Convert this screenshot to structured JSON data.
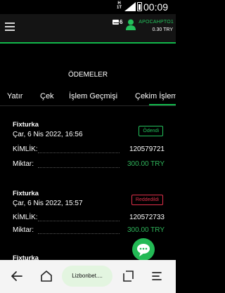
{
  "status_bar": {
    "network": "H",
    "network_sub": "1T",
    "time": "00:09"
  },
  "header": {
    "menu_icon": "hamburger-menu-icon",
    "mail_icon": "envelope-icon",
    "mail_count": "6",
    "avatar_icon": "user-avatar-icon",
    "username": "APOCAHPTO1",
    "balance": "0.30 TRY",
    "accent_color": "#11b84b"
  },
  "page_title": "ÖDEMELER",
  "tabs": [
    {
      "label": "Yatır"
    },
    {
      "label": "Çek"
    },
    {
      "label": "İşlem Geçmişi"
    },
    {
      "label": "Çekim İşlem",
      "active": true
    }
  ],
  "transactions": [
    {
      "title": "Fixturka",
      "date": "Çar, 6 Nis 2022, 16:56",
      "status": "Ödendi",
      "status_color": "#23c15b",
      "id_label": "KİMLİK:",
      "id_value": "120579721",
      "amount_label": "Miktar:",
      "amount_value": "300.00 TRY"
    },
    {
      "title": "Fixturka",
      "date": "Çar, 6 Nis 2022, 15:57",
      "status": "Reddedildi",
      "status_color": "#e0304a",
      "id_label": "KİMLİK:",
      "id_value": "120572733",
      "amount_label": "Miktar:",
      "amount_value": "300.00 TRY"
    },
    {
      "title": "Fixturka"
    }
  ],
  "chat_button_icon": "chat-bubble-icon",
  "browser_nav": {
    "back_icon": "back-arrow-icon",
    "home_icon": "home-icon",
    "url": "Lizbonbet....",
    "tabs_icon": "tabs-icon",
    "menu_icon": "menu-icon"
  }
}
